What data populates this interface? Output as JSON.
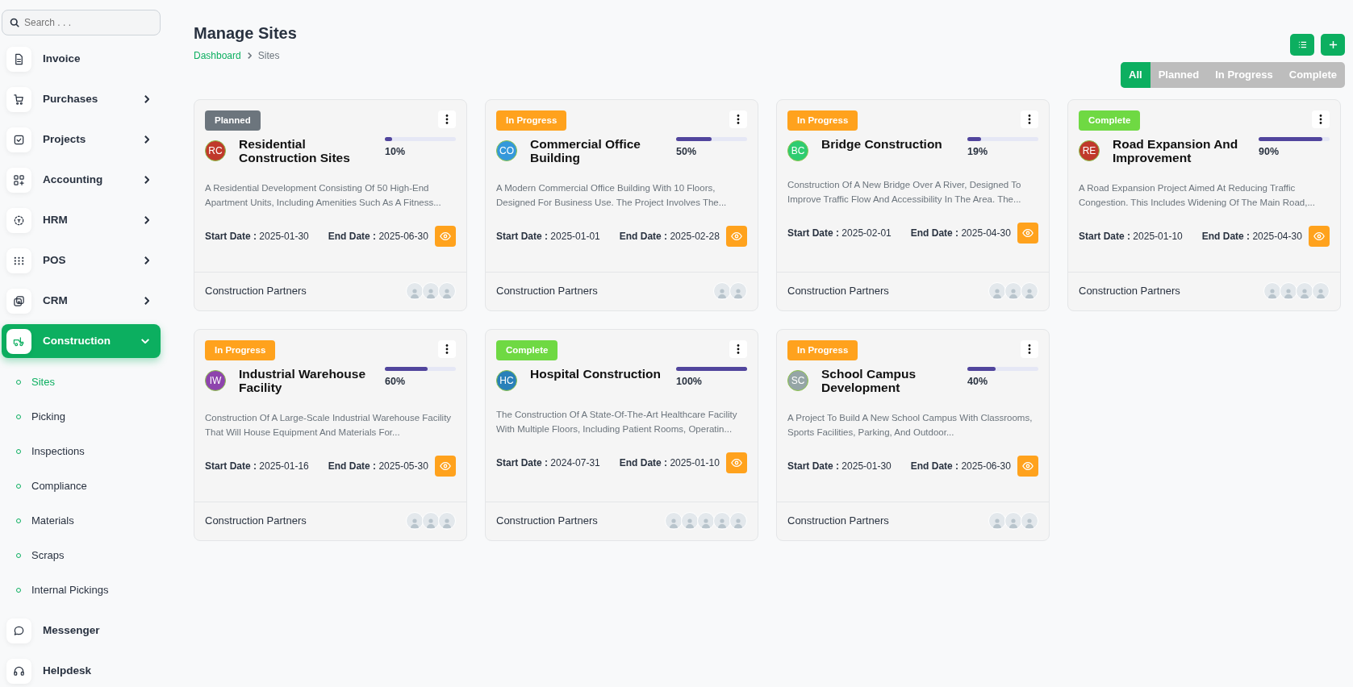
{
  "sidebar": {
    "search": {
      "placeholder": "Search . . ."
    },
    "items": [
      {
        "label": "Invoice",
        "expandable": false,
        "expanded": false,
        "selected": false
      },
      {
        "label": "Purchases",
        "expandable": true,
        "expanded": false,
        "selected": false
      },
      {
        "label": "Projects",
        "expandable": true,
        "expanded": false,
        "selected": false
      },
      {
        "label": "Accounting",
        "expandable": true,
        "expanded": false,
        "selected": false
      },
      {
        "label": "HRM",
        "expandable": true,
        "expanded": false,
        "selected": false
      },
      {
        "label": "POS",
        "expandable": true,
        "expanded": false,
        "selected": false
      },
      {
        "label": "CRM",
        "expandable": true,
        "expanded": false,
        "selected": false
      },
      {
        "label": "Construction",
        "expandable": true,
        "expanded": true,
        "selected": true,
        "children": [
          {
            "label": "Sites",
            "selected": true
          },
          {
            "label": "Picking",
            "selected": false
          },
          {
            "label": "Inspections",
            "selected": false
          },
          {
            "label": "Compliance",
            "selected": false
          },
          {
            "label": "Materials",
            "selected": false
          },
          {
            "label": "Scraps",
            "selected": false
          },
          {
            "label": "Internal Pickings",
            "selected": false
          }
        ]
      },
      {
        "label": "Messenger",
        "expandable": false,
        "expanded": false,
        "selected": false
      },
      {
        "label": "Helpdesk",
        "expandable": false,
        "expanded": false,
        "selected": false
      }
    ]
  },
  "page": {
    "title": "Manage Sites",
    "breadcrumb": [
      "Dashboard",
      "Sites"
    ]
  },
  "filters": [
    {
      "label": "All",
      "selected": true
    },
    {
      "label": "Planned",
      "selected": false
    },
    {
      "label": "In Progress",
      "selected": false
    },
    {
      "label": "Complete",
      "selected": false
    }
  ],
  "sites": [
    {
      "status": {
        "label": "Planned",
        "color": "#6c757d"
      },
      "avatar": {
        "initials": "RC",
        "color": "#c0392b"
      },
      "name": "Residential Construction Sites",
      "level": 0.1,
      "progress": "10%",
      "description": "A Residential Development Consisting Of 50 High-End Apartment Units, Including Amenities Such As A Fitness...",
      "start_label": "Start Date :",
      "start": "2025-01-30",
      "end_label": "End Date :",
      "end": "2025-06-30",
      "client": "Construction Partners",
      "members": [
        {
          "kind": "user"
        },
        {
          "kind": "user"
        },
        {
          "kind": "user"
        }
      ]
    },
    {
      "status": {
        "label": "In Progress",
        "color": "#ffa21d"
      },
      "avatar": {
        "initials": "CO",
        "color": "#3498db"
      },
      "name": "Commercial Office Building",
      "level": 0.5,
      "progress": "50%",
      "description": "A Modern Commercial Office Building With 10 Floors, Designed For Business Use. The Project Involves The...",
      "start_label": "Start Date :",
      "start": "2025-01-01",
      "end_label": "End Date :",
      "end": "2025-02-28",
      "client": "Construction Partners",
      "members": [
        {
          "kind": "user"
        },
        {
          "kind": "user"
        }
      ]
    },
    {
      "status": {
        "label": "In Progress",
        "color": "#ffa21d"
      },
      "avatar": {
        "initials": "BC",
        "color": "#2ecc71"
      },
      "name": "Bridge Construction",
      "level": 0.19,
      "progress": "19%",
      "description": "Construction Of A New Bridge Over A River, Designed To Improve Traffic Flow And Accessibility In The Area. The...",
      "start_label": "Start Date :",
      "start": "2025-02-01",
      "end_label": "End Date :",
      "end": "2025-04-30",
      "client": "Construction Partners",
      "members": [
        {
          "kind": "user"
        },
        {
          "kind": "user"
        },
        {
          "kind": "user"
        }
      ]
    },
    {
      "status": {
        "label": "Complete",
        "color": "#6fd943"
      },
      "avatar": {
        "initials": "RE",
        "color": "#c0392b"
      },
      "name": "Road Expansion And Improvement",
      "level": 0.9,
      "progress": "90%",
      "description": "A Road Expansion Project Aimed At Reducing Traffic Congestion. This Includes Widening Of The Main Road,...",
      "start_label": "Start Date :",
      "start": "2025-01-10",
      "end_label": "End Date :",
      "end": "2025-04-30",
      "client": "Construction Partners",
      "members": [
        {
          "kind": "user"
        },
        {
          "kind": "user"
        },
        {
          "kind": "user"
        },
        {
          "kind": "user"
        }
      ]
    },
    {
      "status": {
        "label": "In Progress",
        "color": "#ffa21d"
      },
      "avatar": {
        "initials": "IW",
        "color": "#8e44ad"
      },
      "name": "Industrial Warehouse Facility",
      "level": 0.6,
      "progress": "60%",
      "description": "Construction Of A Large-Scale Industrial Warehouse Facility That Will House Equipment And Materials For...",
      "start_label": "Start Date :",
      "start": "2025-01-16",
      "end_label": "End Date :",
      "end": "2025-05-30",
      "client": "Construction Partners",
      "members": [
        {
          "kind": "user"
        },
        {
          "kind": "user"
        },
        {
          "kind": "user"
        }
      ]
    },
    {
      "status": {
        "label": "Complete",
        "color": "#6fd943"
      },
      "avatar": {
        "initials": "HC",
        "color": "#2980b9"
      },
      "name": "Hospital Construction",
      "level": 1,
      "progress": "100%",
      "description": "The Construction Of A State-Of-The-Art Healthcare Facility With Multiple Floors, Including Patient Rooms, Operatin...",
      "start_label": "Start Date :",
      "start": "2024-07-31",
      "end_label": "End Date :",
      "end": "2025-01-10",
      "client": "Construction Partners",
      "members": [
        {
          "kind": "user"
        },
        {
          "kind": "user"
        },
        {
          "kind": "user"
        },
        {
          "kind": "user"
        },
        {
          "kind": "user"
        }
      ]
    },
    {
      "status": {
        "label": "In Progress",
        "color": "#ffa21d"
      },
      "avatar": {
        "initials": "SC",
        "color": "#95a5a6"
      },
      "name": "School Campus Development",
      "level": 0.4,
      "progress": "40%",
      "description": "A Project To Build A New School Campus With Classrooms, Sports Facilities, Parking, And Outdoor...",
      "start_label": "Start Date :",
      "start": "2025-01-30",
      "end_label": "End Date :",
      "end": "2025-06-30",
      "client": "Construction Partners",
      "members": [
        {
          "kind": "user"
        },
        {
          "kind": "user"
        },
        {
          "kind": "user"
        }
      ]
    }
  ]
}
